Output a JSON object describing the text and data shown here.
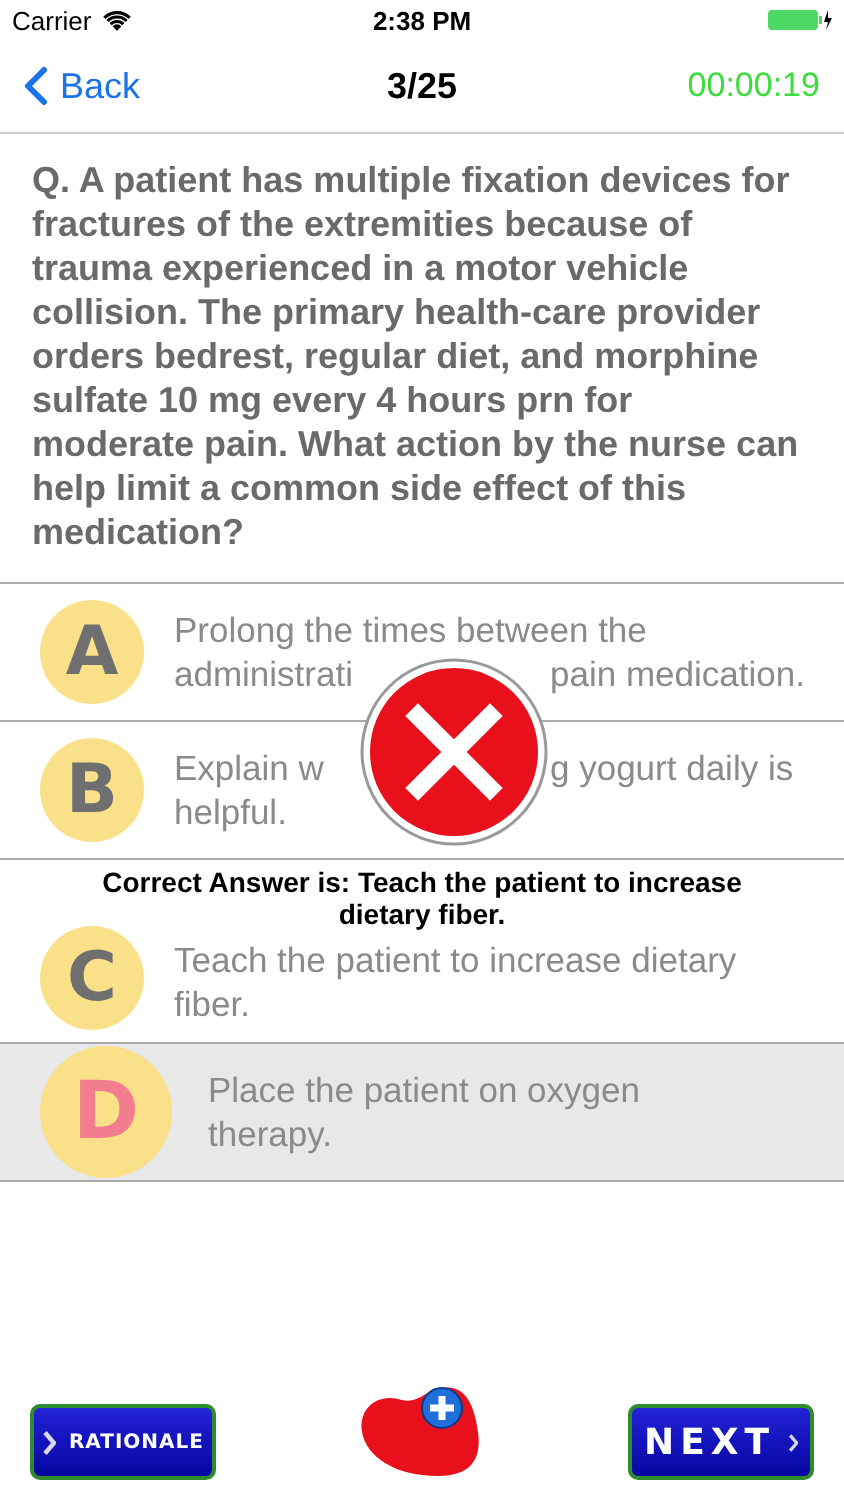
{
  "status_bar": {
    "carrier": "Carrier",
    "time": "2:38 PM"
  },
  "nav": {
    "back": "Back",
    "title": "3/25",
    "timer": "00:00:19"
  },
  "question": "Q. A patient has multiple fixation devices for fractures of the extremities because of trauma experienced in a motor vehicle collision. The primary health-care provider orders bedrest, regular diet, and morphine sulfate 10 mg every 4 hours prn for moderate pain. What action by the nurse can help limit a common side effect of this medication?",
  "options": [
    {
      "letter": "A",
      "selected": false,
      "lines": [
        [
          "Prolong the times between the"
        ],
        [
          "administrati",
          "pain medication."
        ]
      ]
    },
    {
      "letter": "B",
      "selected": false,
      "lines": [
        [
          "Explain w",
          "g yogurt daily is"
        ],
        [
          "helpful."
        ]
      ]
    },
    {
      "letter": "C",
      "selected": false,
      "lines": [
        [
          "Teach the patient to increase dietary"
        ],
        [
          "fiber."
        ]
      ]
    },
    {
      "letter": "D",
      "selected": true,
      "lines": [
        [
          "Place the patient on oxygen"
        ],
        [
          "therapy."
        ]
      ]
    }
  ],
  "result": {
    "kind": "wrong",
    "correct_answer": "Correct Answer is:  Teach the patient to increase dietary fiber."
  },
  "buttons": {
    "rationale": "RATIONALE",
    "next": "NEXT"
  }
}
